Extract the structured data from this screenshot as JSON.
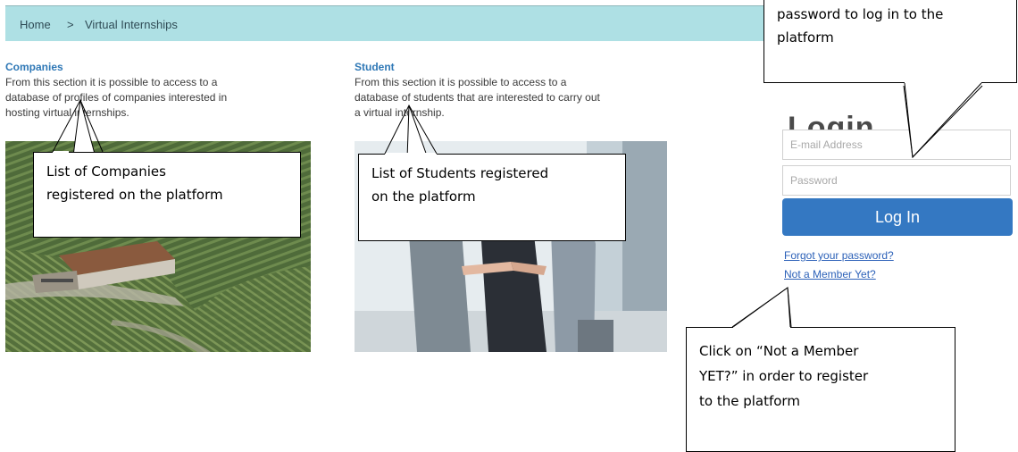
{
  "breadcrumb": {
    "home": "Home",
    "separator": ">",
    "current": "Virtual Internships"
  },
  "companies": {
    "title": "Companies",
    "desc_line1": "From this section it is possible to access to a",
    "desc_line2": "database of profiles of companies interested in",
    "desc_line3": "hosting virtual internships."
  },
  "students": {
    "title": "Student",
    "desc_line1": "From this section it is possible to access to a",
    "desc_line2": "database of students that are interested to carry out",
    "desc_line3": "a virtual internship."
  },
  "login": {
    "title": "Login",
    "email_placeholder": "E-mail Address",
    "password_placeholder": "Password",
    "button_label": "Log In",
    "forgot_link": "Forgot your password?",
    "member_link": "Not a Member Yet?"
  },
  "callouts": {
    "companies_line1": "List of Companies",
    "companies_line2": "registered on the platform",
    "students_line1": "List of Students registered",
    "students_line2": "on the platform",
    "credentials_line1": "password to log in to the",
    "credentials_line2": "platform",
    "register_line1": "Click on “Not a Member",
    "register_line2": "YET?” in order to register",
    "register_line3": "to the platform"
  },
  "colors": {
    "breadcrumb_bg": "#aee0e4",
    "link": "#2f78b6",
    "button": "#3478c2"
  }
}
